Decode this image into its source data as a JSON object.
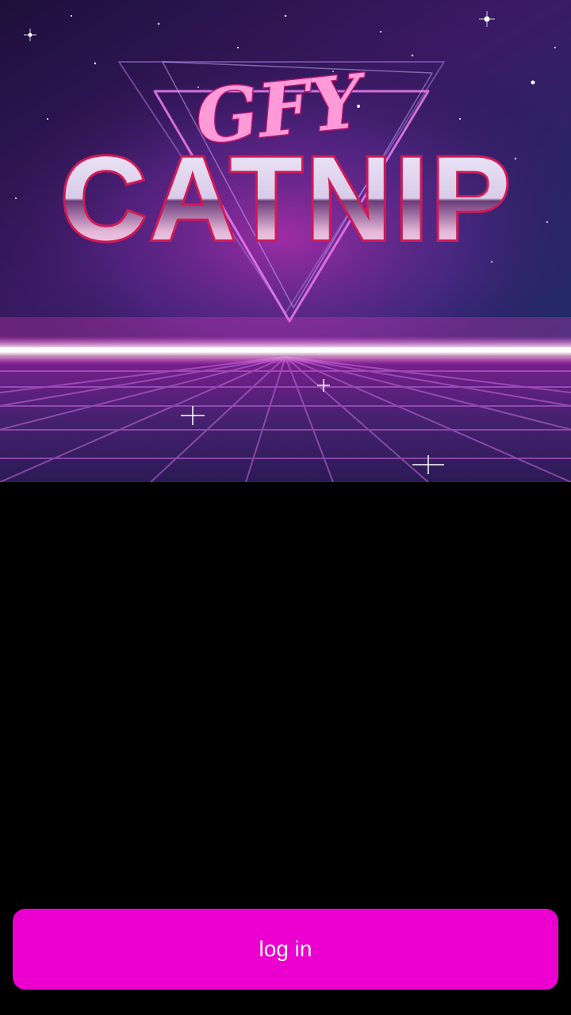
{
  "hero": {
    "artwork_name": "retro-synthwave-logo",
    "logo_script_text": "GFY",
    "logo_main_text": "CATNIP"
  },
  "login": {
    "label": "log in"
  },
  "colors": {
    "background": "#000000",
    "accent": "#ec00cf",
    "button_text": "#ffffff"
  }
}
